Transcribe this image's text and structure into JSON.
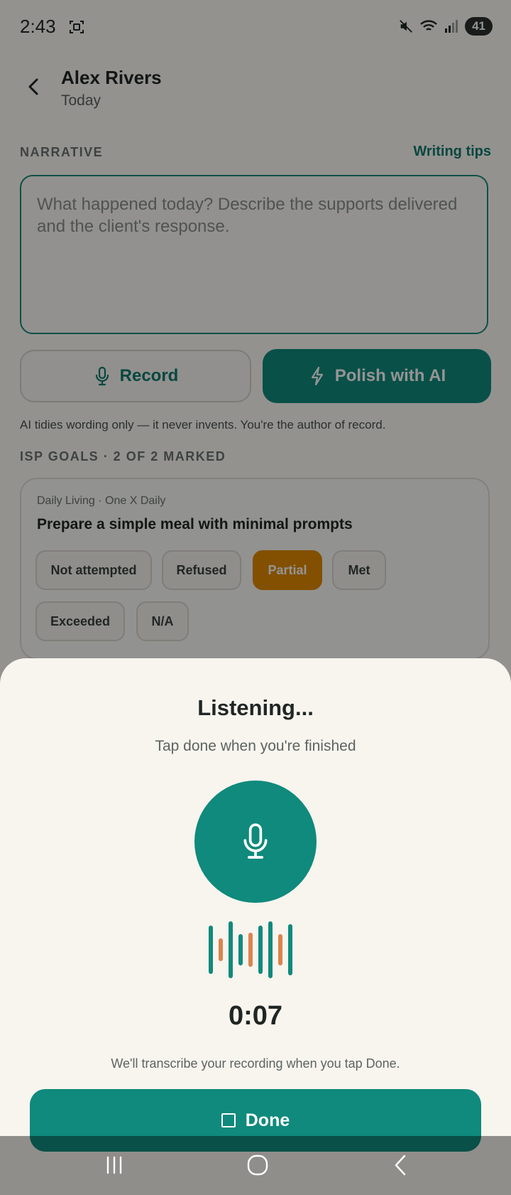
{
  "status_bar": {
    "time": "2:43",
    "battery": "41"
  },
  "header": {
    "title": "Alex Rivers",
    "subtitle": "Today"
  },
  "narrative": {
    "section_label": "NARRATIVE",
    "tips_link": "Writing tips",
    "placeholder": "What happened today? Describe the supports delivered and the client's response."
  },
  "actions": {
    "record_label": "Record",
    "polish_label": "Polish with AI",
    "ai_note": "AI tidies wording only — it never invents. You're the author of record."
  },
  "goals": {
    "section_label": "ISP GOALS · 2 OF 2 MARKED",
    "items": [
      {
        "meta": "Daily Living · One X Daily",
        "title": "Prepare a simple meal with minimal prompts",
        "options": [
          "Not attempted",
          "Refused",
          "Partial",
          "Met",
          "Exceeded",
          "N/A"
        ],
        "selected": "Partial"
      }
    ]
  },
  "recording_sheet": {
    "title": "Listening...",
    "subtitle": "Tap done when you're finished",
    "timer": "0:07",
    "note": "We'll transcribe your recording when you tap Done.",
    "done_label": "Done"
  },
  "colors": {
    "accent": "#0f8a7c",
    "selected_chip": "#e08a00",
    "wave_alt": "#d9844e"
  }
}
